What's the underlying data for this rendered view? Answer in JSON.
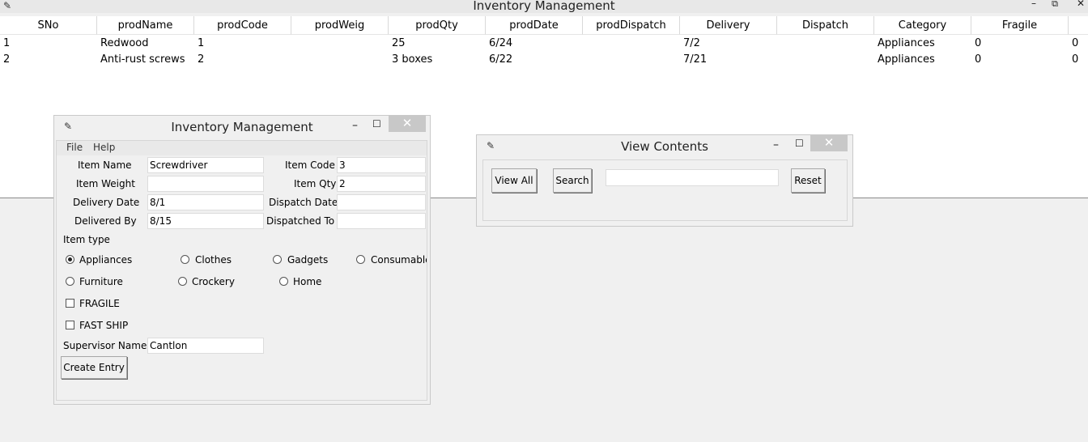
{
  "main": {
    "title": "Inventory Management",
    "icon": "feather-icon",
    "controls": {
      "minimize": "–",
      "restore": "⧉",
      "close": "✕"
    }
  },
  "table": {
    "columns": [
      "SNo",
      "prodName",
      "prodCode",
      "prodWeig",
      "prodQty",
      "prodDate",
      "prodDispatch",
      "Delivery",
      "Dispatch",
      "Category",
      "Fragile"
    ],
    "rows": [
      {
        "sno": "1",
        "name": "Redwood",
        "code": "1",
        "weight": "",
        "qty": "25",
        "date": "6/24",
        "dispatch": "",
        "delivery": "7/2",
        "dispatch2": "",
        "category": "Appliances",
        "fragile": "0",
        "extra": "0"
      },
      {
        "sno": "2",
        "name": "Anti-rust screws",
        "code": "2",
        "weight": "",
        "qty": "3 boxes",
        "date": "6/22",
        "dispatch": "",
        "delivery": "7/21",
        "dispatch2": "",
        "category": "Appliances",
        "fragile": "0",
        "extra": "0"
      }
    ]
  },
  "form": {
    "title": "Inventory Management",
    "menu": [
      "File",
      "Help"
    ],
    "labels": {
      "item_name": "Item Name",
      "item_code": "Item Code",
      "item_weight": "Item Weight",
      "item_qty": "Item Qty",
      "delivery_date": "Delivery Date",
      "dispatch_date": "Dispatch Date",
      "delivered_by": "Delivered By",
      "dispatched_to": "Dispatched To",
      "item_type": "Item type",
      "supervisor": "Supervisor Name"
    },
    "values": {
      "item_name": "Screwdriver",
      "item_code": "3",
      "item_weight": "",
      "item_qty": "2",
      "delivery_date": "8/1",
      "dispatch_date": "",
      "delivered_by": "8/15",
      "dispatched_to": "",
      "supervisor": "Cantlon"
    },
    "item_types": [
      "Appliances",
      "Clothes",
      "Gadgets",
      "Consumable",
      "Furniture",
      "Crockery",
      "Home"
    ],
    "selected_type": "Appliances",
    "checkboxes": {
      "fragile": "FRAGILE",
      "fast_ship": "FAST SHIP"
    },
    "create_button": "Create Entry"
  },
  "view": {
    "title": "View Contents",
    "view_all": "View All",
    "search": "Search",
    "search_value": "",
    "reset": "Reset"
  }
}
